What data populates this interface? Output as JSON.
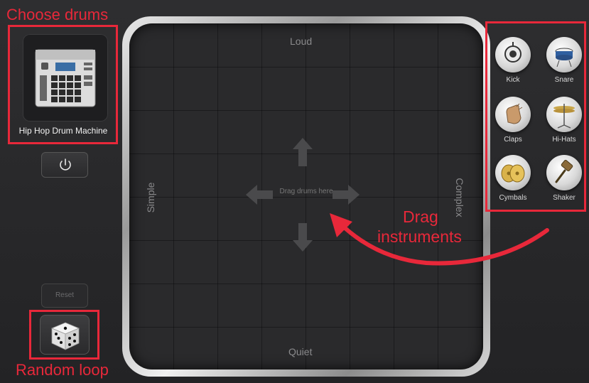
{
  "kit": {
    "name": "Hip Hop Drum Machine"
  },
  "controls": {
    "reset_label": "Reset",
    "power_icon": "power-icon",
    "dice_icon": "dice-icon"
  },
  "pad": {
    "top_label": "Loud",
    "bottom_label": "Quiet",
    "left_label": "Simple",
    "right_label": "Complex",
    "center_hint": "Drag drums here"
  },
  "instruments": [
    {
      "label": "Kick",
      "icon": "kick-drum-icon"
    },
    {
      "label": "Snare",
      "icon": "snare-drum-icon"
    },
    {
      "label": "Claps",
      "icon": "clap-hands-icon"
    },
    {
      "label": "Hi-Hats",
      "icon": "hi-hat-icon"
    },
    {
      "label": "Cymbals",
      "icon": "cymbals-icon"
    },
    {
      "label": "Shaker",
      "icon": "shaker-icon"
    }
  ],
  "annotations": {
    "choose_drums": "Choose drums",
    "random_loop": "Random loop",
    "drag_line1": "Drag",
    "drag_line2": "instruments"
  },
  "colors": {
    "annotation": "#e8283a",
    "background": "#28282a",
    "pad_frame": "#c8c8c8"
  }
}
